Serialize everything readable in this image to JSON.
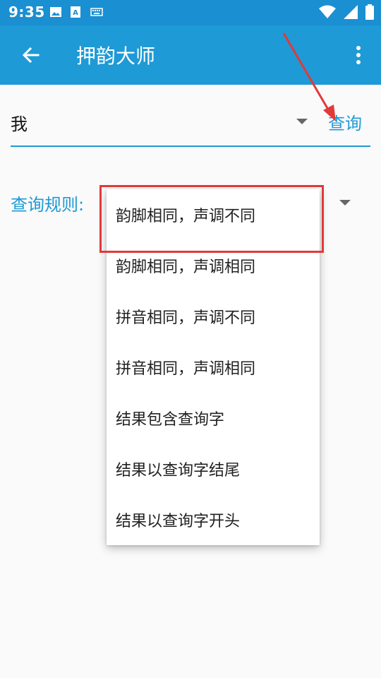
{
  "status_bar": {
    "time": "9:35",
    "left_icons": [
      "image-icon",
      "text-a-icon",
      "keyboard-icon"
    ],
    "right_icons": [
      "wifi-icon",
      "signal-icon",
      "battery-icon"
    ]
  },
  "app_bar": {
    "title": "押韵大师",
    "back_icon": "arrow-left-icon",
    "overflow_icon": "more-vert-icon",
    "color": "#1e9ad6"
  },
  "query": {
    "input_value": "我",
    "button_label": "查询"
  },
  "rule": {
    "label": "查询规则:",
    "options": [
      "韵脚相同，声调不同",
      "韵脚相同，声调相同",
      "拼音相同，声调不同",
      "拼音相同，声调相同",
      "结果包含查询字",
      "结果以查询字结尾",
      "结果以查询字开头"
    ]
  },
  "colors": {
    "accent": "#1e9ad6",
    "status_bar": "#1a8fd1",
    "annotation": "#e03a3a"
  }
}
